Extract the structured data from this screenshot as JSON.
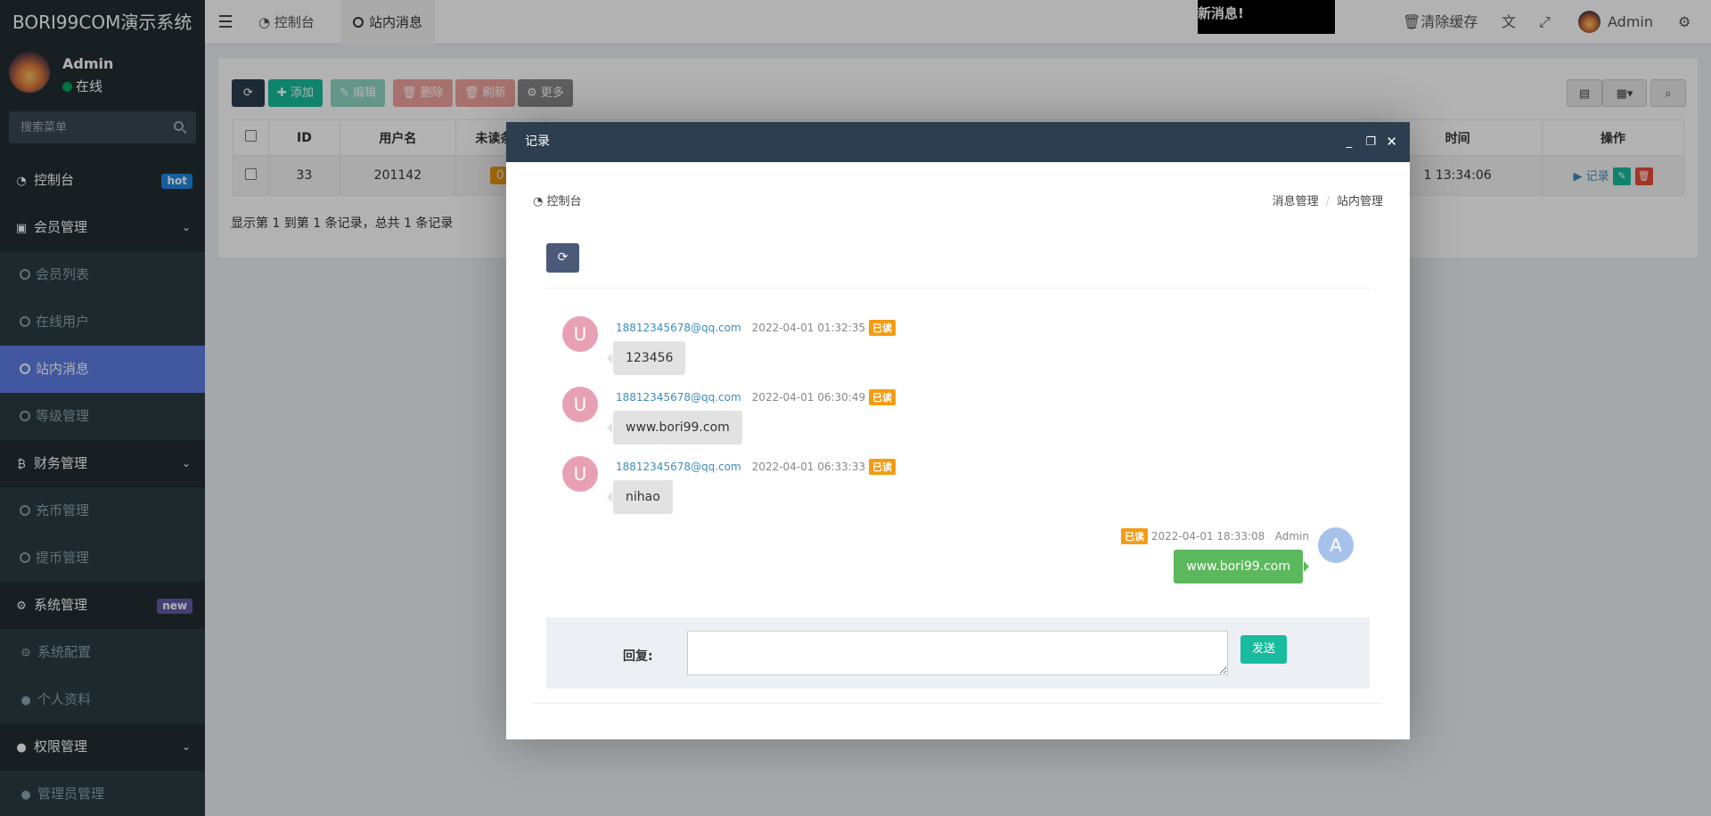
{
  "app": {
    "logo": "BORI99COM演示系统"
  },
  "user": {
    "name": "Admin",
    "status": "在线"
  },
  "search": {
    "placeholder": "搜索菜单"
  },
  "sidebar": {
    "dashboard": {
      "label": "控制台",
      "badge": "hot"
    },
    "member": {
      "label": "会员管理",
      "items": [
        "会员列表",
        "在线用户",
        "站内消息",
        "等级管理"
      ]
    },
    "finance": {
      "label": "财务管理",
      "items": [
        "充币管理",
        "提币管理"
      ]
    },
    "system": {
      "label": "系统管理",
      "badge": "new",
      "items": [
        "系统配置",
        "个人资料"
      ]
    },
    "auth": {
      "label": "权限管理",
      "items": [
        "管理员管理"
      ]
    }
  },
  "header": {
    "tabs": [
      "控制台",
      "站内消息"
    ],
    "notice": "新消息!",
    "clear_cache": "清除缓存",
    "user": "Admin"
  },
  "toolbar": {
    "add": "添加",
    "edit": "编辑",
    "delete": "删除",
    "refresh": "刷新",
    "more": "更多"
  },
  "table": {
    "headers": [
      "ID",
      "用户名",
      "未读条数",
      "时间",
      "操作"
    ],
    "rows": [
      {
        "id": "33",
        "username": "201142",
        "unread": "0",
        "time": "1 13:34:06",
        "action_record": "记录"
      }
    ],
    "pageinfo": "显示第 1 到第 1 条记录，总共 1 条记录"
  },
  "modal": {
    "title": "记录",
    "breadcrumb_left": "控制台",
    "breadcrumb_right": [
      "消息管理",
      "站内管理"
    ],
    "messages": [
      {
        "avatar": "U",
        "email": "18812345678@qq.com",
        "time": "2022-04-01 01:32:35",
        "badge": "已读",
        "text": "123456"
      },
      {
        "avatar": "U",
        "email": "18812345678@qq.com",
        "time": "2022-04-01 06:30:49",
        "badge": "已读",
        "text": "www.bori99.com"
      },
      {
        "avatar": "U",
        "email": "18812345678@qq.com",
        "time": "2022-04-01 06:33:33",
        "badge": "已读",
        "text": "nihao"
      },
      {
        "avatar": "A",
        "email": "Admin",
        "time": "2022-04-01 18:33:08",
        "badge": "已读",
        "text": "www.bori99.com"
      }
    ],
    "reply_label": "回复:",
    "send": "发送"
  },
  "colors": {
    "sidebar": "#222d32",
    "active": "#5d7ee5",
    "modal_header": "#2c3e50",
    "read_badge": "#f39c12",
    "send": "#18bc9c"
  }
}
